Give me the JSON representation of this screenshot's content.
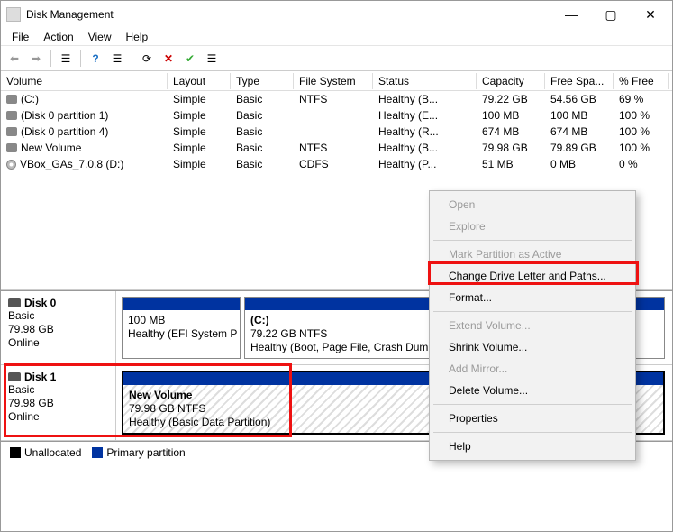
{
  "window": {
    "title": "Disk Management"
  },
  "menu": {
    "file": "File",
    "action": "Action",
    "view": "View",
    "help": "Help"
  },
  "columns": {
    "volume": "Volume",
    "layout": "Layout",
    "type": "Type",
    "fs": "File System",
    "status": "Status",
    "capacity": "Capacity",
    "free": "Free Spa...",
    "pct": "% Free"
  },
  "rows": [
    {
      "name": "(C:)",
      "layout": "Simple",
      "type": "Basic",
      "fs": "NTFS",
      "status": "Healthy (B...",
      "capacity": "79.22 GB",
      "free": "54.56 GB",
      "pct": "69 %"
    },
    {
      "name": "(Disk 0 partition 1)",
      "layout": "Simple",
      "type": "Basic",
      "fs": "",
      "status": "Healthy (E...",
      "capacity": "100 MB",
      "free": "100 MB",
      "pct": "100 %"
    },
    {
      "name": "(Disk 0 partition 4)",
      "layout": "Simple",
      "type": "Basic",
      "fs": "",
      "status": "Healthy (R...",
      "capacity": "674 MB",
      "free": "674 MB",
      "pct": "100 %"
    },
    {
      "name": "New Volume",
      "layout": "Simple",
      "type": "Basic",
      "fs": "NTFS",
      "status": "Healthy (B...",
      "capacity": "79.98 GB",
      "free": "79.89 GB",
      "pct": "100 %"
    },
    {
      "name": "VBox_GAs_7.0.8 (D:)",
      "layout": "Simple",
      "type": "Basic",
      "fs": "CDFS",
      "status": "Healthy (P...",
      "capacity": "51 MB",
      "free": "0 MB",
      "pct": "0 %",
      "cd": true
    }
  ],
  "disks": {
    "d0": {
      "title": "Disk 0",
      "type": "Basic",
      "size": "79.98 GB",
      "state": "Online",
      "vol0": {
        "line1": "",
        "line2": "100 MB",
        "line3": "Healthy (EFI System P"
      },
      "vol1": {
        "line1": "(C:)",
        "line2": "79.22 GB NTFS",
        "line3": "Healthy (Boot, Page File, Crash Dump, B"
      }
    },
    "d1": {
      "title": "Disk 1",
      "type": "Basic",
      "size": "79.98 GB",
      "state": "Online",
      "vol0": {
        "line1": "New Volume",
        "line2": "79.98 GB NTFS",
        "line3": "Healthy (Basic Data Partition)"
      }
    }
  },
  "legend": {
    "unalloc": "Unallocated",
    "primary": "Primary partition"
  },
  "ctx": {
    "open": "Open",
    "explore": "Explore",
    "mark": "Mark Partition as Active",
    "change": "Change Drive Letter and Paths...",
    "format": "Format...",
    "extend": "Extend Volume...",
    "shrink": "Shrink Volume...",
    "addmirror": "Add Mirror...",
    "delete": "Delete Volume...",
    "props": "Properties",
    "help": "Help"
  }
}
